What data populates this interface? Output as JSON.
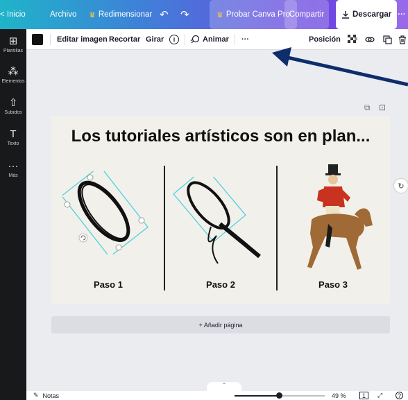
{
  "topbar": {
    "back_label": "< Inicio",
    "file_label": "Archivo",
    "resize_label": "Redimensionar",
    "undo_glyph": "↶",
    "redo_glyph": "↷",
    "pro_label": "Probar Canva Pro",
    "share_label": "Compartir",
    "download_label": "Descargar",
    "more_glyph": "···",
    "crown_glyph": "♛"
  },
  "sidebar": {
    "items": [
      {
        "icon": "templates-icon",
        "glyph": "⊞",
        "label": "Plantillas"
      },
      {
        "icon": "elements-icon",
        "glyph": "⁂",
        "label": "Elementos"
      },
      {
        "icon": "upload-icon",
        "glyph": "⇧",
        "label": "Subidos"
      },
      {
        "icon": "text-icon",
        "glyph": "T",
        "label": "Texto"
      },
      {
        "icon": "more-icon",
        "glyph": "···",
        "label": "Más"
      }
    ]
  },
  "toolbar": {
    "edit_image": "Editar imagen",
    "crop": "Recortar",
    "rotate": "Girar",
    "info_glyph": "i",
    "animate": "Animar",
    "more_glyph": "···",
    "position": "Posición",
    "color": "#111111"
  },
  "page": {
    "title": "Los tutoriales artísticos son en plan...",
    "steps": [
      {
        "label": "Paso 1"
      },
      {
        "label": "Paso 2"
      },
      {
        "label": "Paso 3"
      }
    ],
    "background": "#f2f0ea",
    "selection_color": "#4fd1e0"
  },
  "add_page": "+ Añadir página",
  "bottombar": {
    "notes": "Notas",
    "zoom": "49 %",
    "zoom_fraction": 0.49,
    "page_count": "1",
    "expand_glyph": "⤢",
    "help_glyph": "?"
  },
  "colors": {
    "arrow": "#0d2d6b",
    "sidebar_bg": "#18191b",
    "workspace_bg": "#ebecf0"
  }
}
